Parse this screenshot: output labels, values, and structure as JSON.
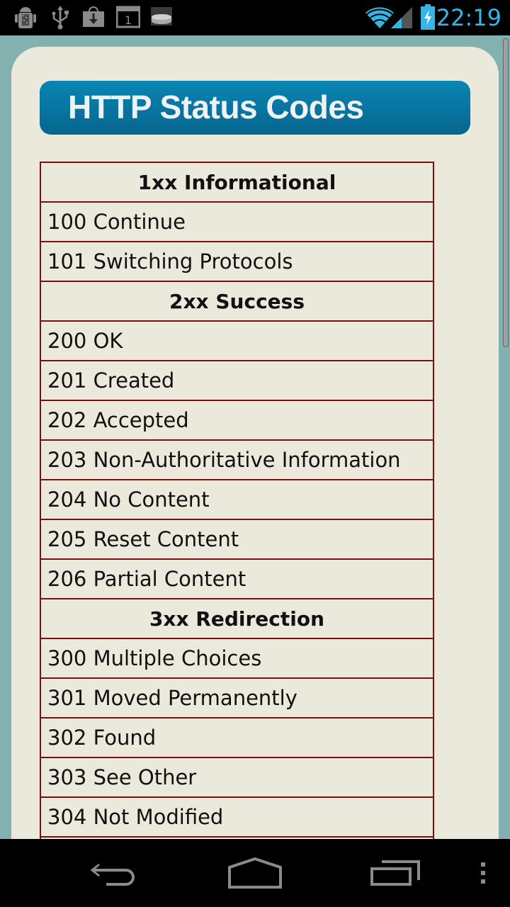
{
  "status_bar": {
    "time": "22:19",
    "left_icons": [
      "android-debug-icon",
      "usb-icon",
      "download-icon",
      "calendar-icon",
      "storage-icon"
    ],
    "right_icons": [
      "wifi-icon",
      "signal-icon",
      "battery-charging-icon"
    ],
    "calendar_day": "1",
    "accent_color": "#33b5e5"
  },
  "app": {
    "title": "HTTP Status Codes",
    "table": [
      {
        "type": "section",
        "label": "1xx Informational"
      },
      {
        "type": "code",
        "label": "100 Continue"
      },
      {
        "type": "code",
        "label": "101 Switching Protocols"
      },
      {
        "type": "section",
        "label": "2xx Success"
      },
      {
        "type": "code",
        "label": "200 OK"
      },
      {
        "type": "code",
        "label": "201 Created"
      },
      {
        "type": "code",
        "label": "202 Accepted"
      },
      {
        "type": "code",
        "label": "203 Non-Authoritative Information"
      },
      {
        "type": "code",
        "label": "204 No Content"
      },
      {
        "type": "code",
        "label": "205 Reset Content"
      },
      {
        "type": "code",
        "label": "206 Partial Content"
      },
      {
        "type": "section",
        "label": "3xx Redirection"
      },
      {
        "type": "code",
        "label": "300 Multiple Choices"
      },
      {
        "type": "code",
        "label": "301 Moved Permanently"
      },
      {
        "type": "code",
        "label": "302 Found"
      },
      {
        "type": "code",
        "label": "303 See Other"
      },
      {
        "type": "code",
        "label": "304 Not Modified"
      },
      {
        "type": "code",
        "label": ""
      }
    ],
    "colors": {
      "background": "#82b1b0",
      "card": "#ebe8dc",
      "title_bar": "#0874a0",
      "table_border": "#7a1010"
    }
  },
  "nav_bar": {
    "buttons": [
      "back",
      "home",
      "recent-apps",
      "menu"
    ]
  }
}
